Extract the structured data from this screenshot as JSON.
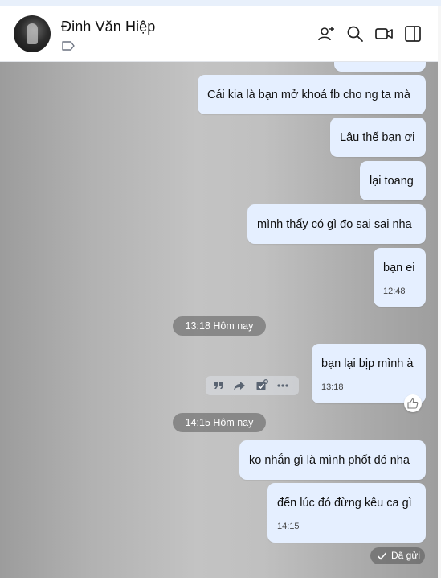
{
  "contact": {
    "name": "Đinh Văn Hiệp"
  },
  "messages": [
    {
      "text": "Cái kia là bạn mở khoá fb cho ng ta mà"
    },
    {
      "text": "Lâu thế bạn ơi"
    },
    {
      "text": "lại toang"
    },
    {
      "text": "mình thấy có gì đo sai sai nha"
    },
    {
      "text": "bạn ei",
      "time": "12:48"
    },
    {
      "text": "bạn lại bịp mình à",
      "time": "13:18"
    },
    {
      "text": "ko nhắn gì là mình phốt đó nha"
    },
    {
      "text": "đến lúc đó đừng kêu ca gì",
      "time": "14:15"
    }
  ],
  "separators": [
    "13:18 Hôm nay",
    "14:15 Hôm nay"
  ],
  "status": {
    "sent_label": "Đã gửi"
  },
  "icons": {
    "header": [
      "add-member-icon",
      "search-icon",
      "video-call-icon",
      "sidebar-toggle-icon"
    ],
    "message_toolbar": [
      "quote-icon",
      "forward-icon",
      "task-icon",
      "more-icon"
    ],
    "reaction": "thumbs-up-icon",
    "tag": "tag-icon"
  },
  "colors": {
    "bubble": "#e5efff",
    "header_bg": "#ffffff"
  }
}
